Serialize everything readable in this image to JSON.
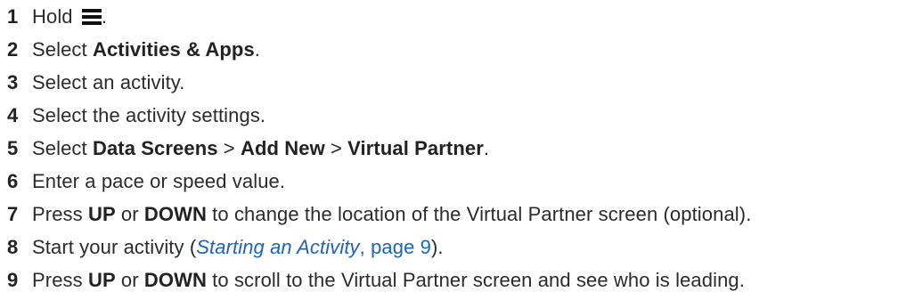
{
  "steps": [
    {
      "num": "1",
      "before": "Hold ",
      "icon": "menu-icon",
      "after": "."
    },
    {
      "num": "2",
      "pre": "Select ",
      "bold": "Activities & Apps",
      "post": "."
    },
    {
      "num": "3",
      "text": "Select an activity."
    },
    {
      "num": "4",
      "text": "Select the activity settings."
    },
    {
      "num": "5",
      "pre": "Select ",
      "b1": "Data Screens",
      "sep1": " > ",
      "b2": "Add New",
      "sep2": " > ",
      "b3": "Virtual Partner",
      "post": "."
    },
    {
      "num": "6",
      "text": "Enter a pace or speed value."
    },
    {
      "num": "7",
      "pre": "Press ",
      "b1": "UP",
      "mid": " or ",
      "b2": "DOWN",
      "post": " to change the location of the Virtual Partner screen (optional)."
    },
    {
      "num": "8",
      "pre": "Start your activity (",
      "link_title": "Starting an Activity",
      "link_page": ", page 9",
      "post": ")."
    },
    {
      "num": "9",
      "pre": "Press ",
      "b1": "UP",
      "mid": " or ",
      "b2": "DOWN",
      "post": " to scroll to the Virtual Partner screen and see who is leading."
    }
  ]
}
